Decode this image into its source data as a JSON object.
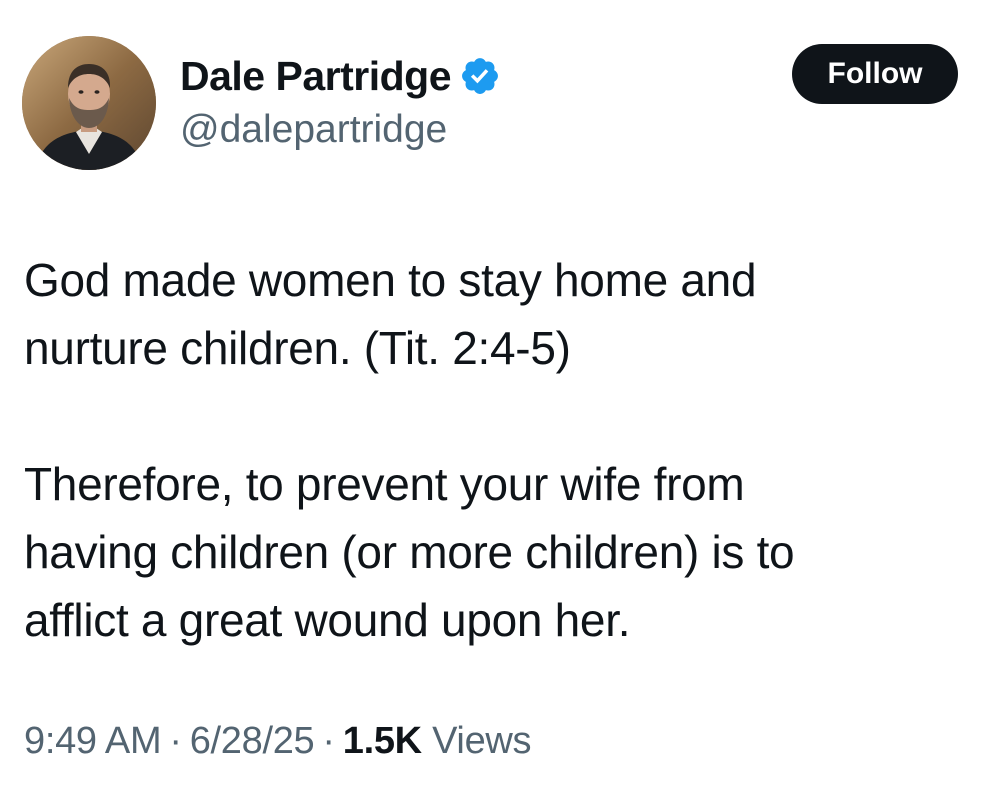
{
  "author": {
    "display_name": "Dale Partridge",
    "handle": "@dalepartridge",
    "verified": true,
    "verified_icon": "verified-badge-icon",
    "verified_color": "#1d9bf0"
  },
  "actions": {
    "follow_label": "Follow"
  },
  "tweet": {
    "lines": [
      "God made women to stay home and",
      "nurture children. (Tit. 2:4-5)",
      "Therefore, to prevent your wife from",
      "having children (or more children) is to",
      "afflict a great wound upon her."
    ]
  },
  "meta": {
    "time": "9:49 AM",
    "separator": "·",
    "date": "6/28/25",
    "views_count": "1.5K",
    "views_label": "Views"
  },
  "colors": {
    "text": "#0f1419",
    "secondary": "#536471",
    "button_bg": "#0f1419",
    "button_text": "#ffffff"
  }
}
